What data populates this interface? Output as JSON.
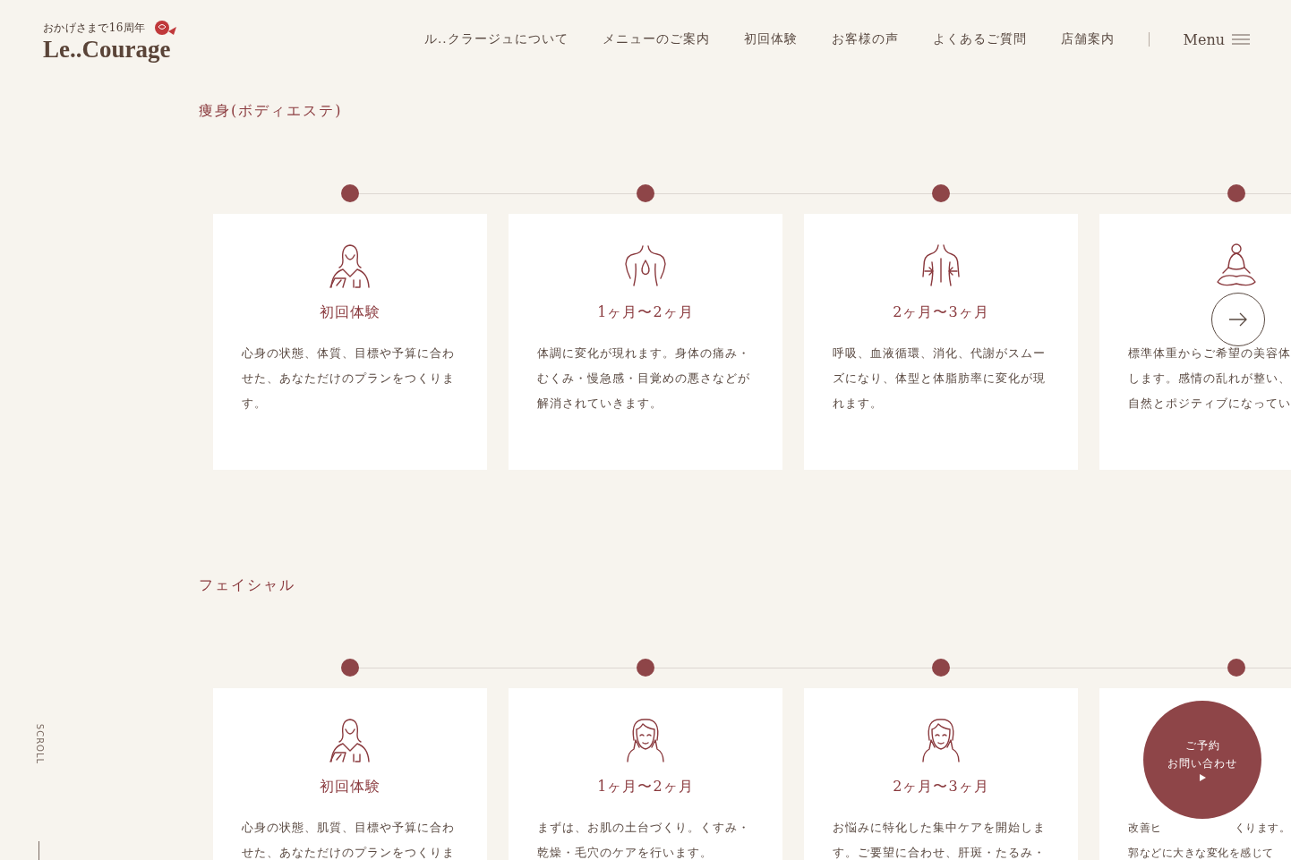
{
  "header": {
    "tagline": "おかげさまで16周年",
    "logo": "Le..Courage",
    "nav": [
      "ル..クラージュについて",
      "メニューのご案内",
      "初回体験",
      "お客様の声",
      "よくあるご質問",
      "店舗案内"
    ],
    "menu": "Menu"
  },
  "sections": [
    {
      "title": "痩身(ボディエステ)",
      "cards": [
        {
          "kind": "full",
          "title": "初回体験",
          "description": "心身の状態、体質、目標や予算に合わせた、あなただけのプランをつくります。"
        },
        {
          "kind": "full",
          "title": "1ヶ月〜2ヶ月",
          "description": "体調に変化が現れます。身体の痛み・むくみ・慢急感・目覚めの悪さなどが解消されていきます。"
        },
        {
          "kind": "full",
          "title": "2ヶ月〜3ヶ月",
          "description": "呼吸、血液循環、消化、代謝がスムーズになり、体型と体脂肪率に変化が現れます。"
        },
        {
          "kind": "partial",
          "description": "標準体重からご希望の美容体します。感情の乱れが整い、自然とポジティブになってい"
        }
      ]
    },
    {
      "title": "フェイシャル",
      "cards": [
        {
          "kind": "full",
          "title": "初回体験",
          "description": "心身の状態、肌質、目標や予算に合わせた、あなただけのプランをつくりま"
        },
        {
          "kind": "full",
          "title": "1ヶ月〜2ヶ月",
          "description": "まずは、お肌の土台づくり。くすみ・乾燥・毛穴のケアを行います。"
        },
        {
          "kind": "full",
          "title": "2ヶ月〜3ヶ月",
          "description": "お悩みに特化した集中ケアを開始します。ご要望に合わせ、肝斑・たるみ・"
        },
        {
          "kind": "covered",
          "lines": [
            [
              "改善ヒ",
              "くります。"
            ],
            [
              "郭などに大きな変化を感じて"
            ]
          ]
        }
      ]
    }
  ],
  "scroll": "SCROLL",
  "contact": {
    "lines": [
      "ご予約",
      "お問い合わせ"
    ]
  }
}
